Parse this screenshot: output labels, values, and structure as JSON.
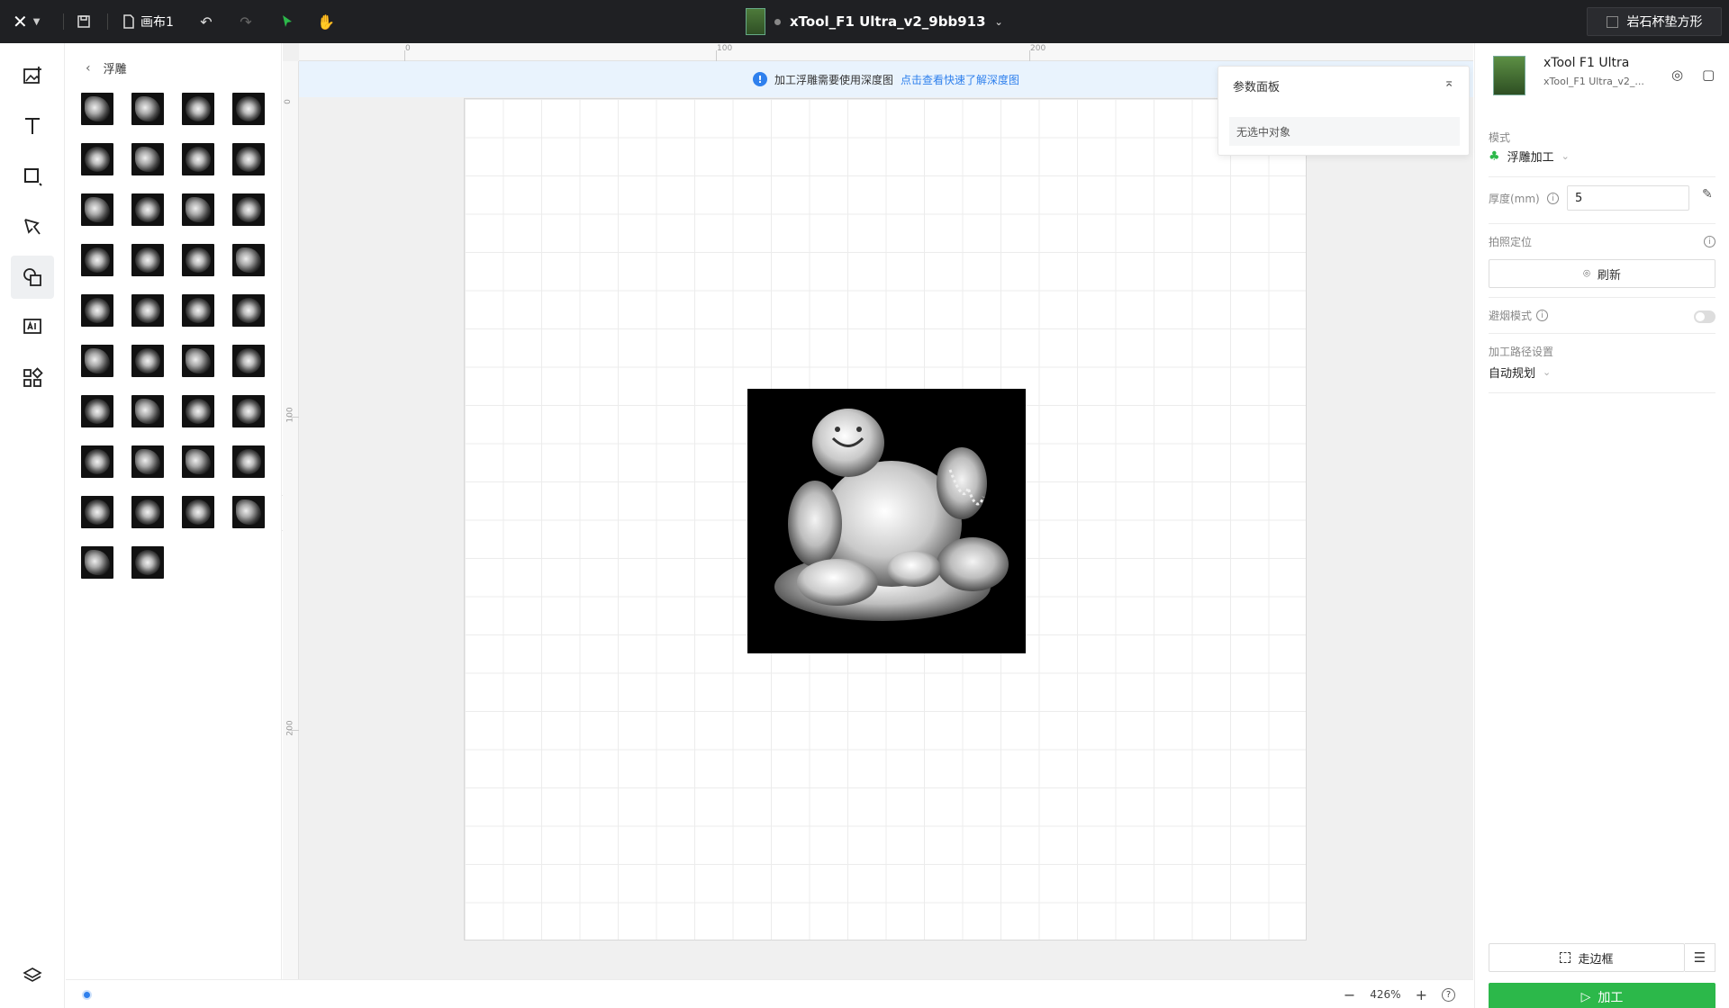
{
  "topbar": {
    "logo": "✕",
    "canvas_name": "画布1",
    "device_title": "xTool_F1 Ultra_v2_9bb913",
    "preset_label": "岩石杯垫方形"
  },
  "rail": {
    "items": [
      "add-image",
      "text",
      "shape",
      "pen",
      "elements",
      "ai",
      "apps",
      "layers"
    ]
  },
  "library": {
    "title": "浮雕",
    "tile_count": 38
  },
  "notice": {
    "text": "加工浮雕需要使用深度图",
    "link": "点击查看快速了解深度图"
  },
  "ruler": {
    "top_labels": [
      "0",
      "100",
      "200"
    ],
    "left_labels": [
      "0",
      "100",
      "200"
    ]
  },
  "param_panel": {
    "title": "参数面板",
    "empty_text": "无选中对象"
  },
  "status": {
    "zoom": "426%",
    "zoom_out": "−",
    "zoom_in": "+",
    "help": "?"
  },
  "right_panel": {
    "device_name": "xTool F1 Ultra",
    "device_sub": "xTool_F1 Ultra_v2_...",
    "mode_label": "模式",
    "mode_value": "浮雕加工",
    "thickness_label": "厚度(mm)",
    "thickness_value": "5",
    "camera_label": "拍照定位",
    "refresh_label": "刷新",
    "smoke_label": "避烟模式",
    "path_label": "加工路径设置",
    "path_value": "自动规划",
    "frame_label": "走边框",
    "process_label": "加工"
  },
  "colors": {
    "topbar": "#1f2023",
    "accent_blue": "#2f80ed",
    "process_green": "#2cb84a"
  }
}
